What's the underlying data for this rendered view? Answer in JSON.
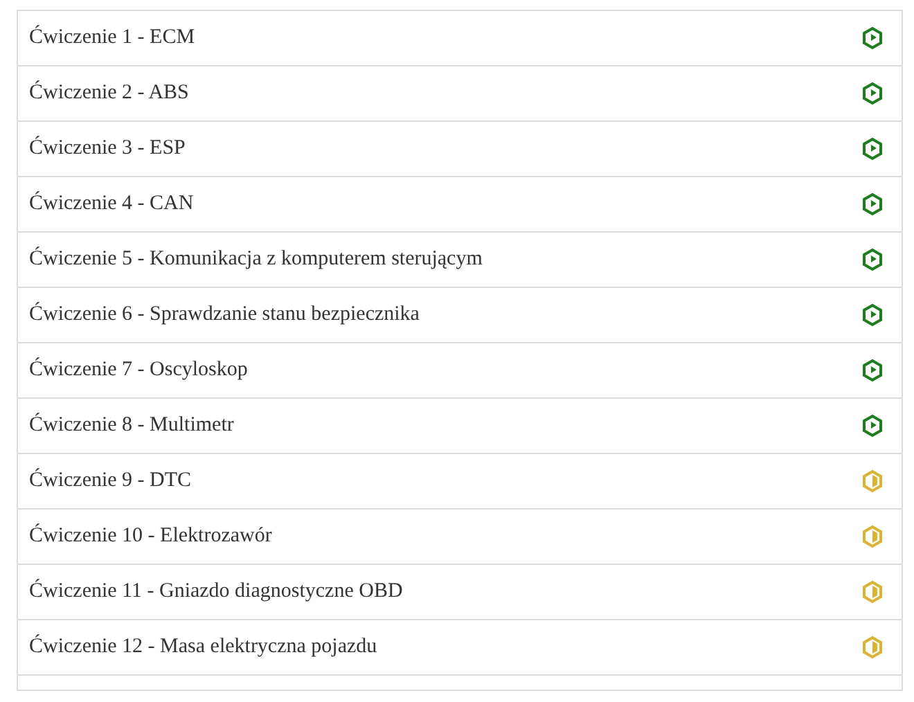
{
  "exercises": [
    {
      "title": "Ćwiczenie 1 - ECM",
      "kind": "complete"
    },
    {
      "title": "Ćwiczenie 2 - ABS",
      "kind": "complete"
    },
    {
      "title": "Ćwiczenie 3 - ESP",
      "kind": "complete"
    },
    {
      "title": "Ćwiczenie 4 - CAN",
      "kind": "complete"
    },
    {
      "title": "Ćwiczenie 5 - Komunikacja z komputerem sterującym",
      "kind": "complete"
    },
    {
      "title": "Ćwiczenie 6 - Sprawdzanie stanu bezpiecznika",
      "kind": "complete"
    },
    {
      "title": "Ćwiczenie 7 - Oscyloskop",
      "kind": "complete"
    },
    {
      "title": "Ćwiczenie 8 - Multimetr",
      "kind": "complete"
    },
    {
      "title": "Ćwiczenie 9 - DTC",
      "kind": "partial"
    },
    {
      "title": "Ćwiczenie 10 - Elektrozawór",
      "kind": "partial"
    },
    {
      "title": "Ćwiczenie 11 - Gniazdo diagnostyczne OBD",
      "kind": "partial"
    },
    {
      "title": "Ćwiczenie 12 - Masa elektryczna pojazdu",
      "kind": "partial"
    }
  ]
}
